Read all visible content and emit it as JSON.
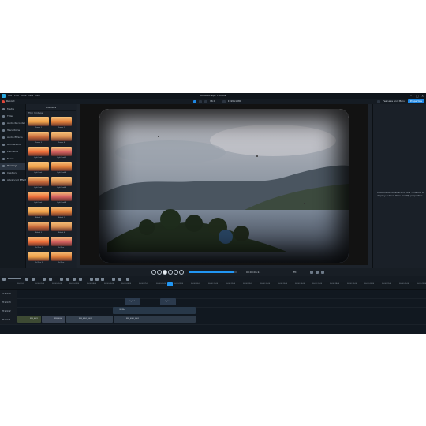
{
  "menubar": {
    "items": [
      "File",
      "Edit",
      "Tools",
      "View",
      "Help"
    ],
    "title": "Untitled.wfp - Filmora"
  },
  "toolbar": {
    "record_label": "Record",
    "aspect": "16:9",
    "resolution": "1920x1080",
    "features_label": "Features and Menu",
    "properties_label": "Properties"
  },
  "sidebar": {
    "items": [
      {
        "label": "Media",
        "icon": "media-icon"
      },
      {
        "label": "Titles",
        "icon": "text-icon"
      },
      {
        "label": "Audio Recorder",
        "icon": "microphone-icon"
      },
      {
        "label": "Transitions",
        "icon": "transition-icon"
      },
      {
        "label": "Audio Effects",
        "icon": "audio-icon"
      },
      {
        "label": "Animations",
        "icon": "animation-icon"
      },
      {
        "label": "Elements",
        "icon": "element-icon"
      },
      {
        "label": "Music",
        "icon": "music-icon"
      },
      {
        "label": "Overlays",
        "icon": "overlay-icon"
      },
      {
        "label": "Captions",
        "icon": "caption-icon"
      },
      {
        "label": "Advanced Effects",
        "icon": "effects-icon"
      }
    ],
    "active_index": 8
  },
  "filters": {
    "header": "Overlays",
    "search": "Film   Vintage",
    "items": [
      {
        "label": "Frame 1"
      },
      {
        "label": "Frame 2"
      },
      {
        "label": "Frame 3"
      },
      {
        "label": "Frame 4"
      },
      {
        "label": "Light Leak 1"
      },
      {
        "label": "Light Leak 2"
      },
      {
        "label": "Light Leak 3"
      },
      {
        "label": "Light Leak 4"
      },
      {
        "label": "Light Leak 5"
      },
      {
        "label": "Light Leak 6"
      },
      {
        "label": "Light Leak 7"
      },
      {
        "label": "Light Leak 8"
      },
      {
        "label": "Bokeh 1"
      },
      {
        "label": "Bokeh 2"
      },
      {
        "label": "Bokeh 3"
      },
      {
        "label": "Bokeh 4"
      },
      {
        "label": "Old Film 1"
      },
      {
        "label": "Old Film 2"
      },
      {
        "label": "Old Film 3"
      },
      {
        "label": "Old Film 4"
      }
    ]
  },
  "playback": {
    "current_time": "00:00:06:13",
    "fit_label": "Fit",
    "progress": 0.95
  },
  "properties": {
    "message": "Click media or effects in the Timeline to display it here, then modify properties."
  },
  "timeline": {
    "ruler_ticks": [
      "00:00:00",
      "00:00:01:00",
      "00:00:02:00",
      "00:00:03:00",
      "00:00:04:00",
      "00:00:05:00",
      "00:00:06:00",
      "00:00:07:00",
      "00:00:08:00",
      "00:00:09:00",
      "00:00:10:00",
      "00:00:11:00",
      "00:00:12:00",
      "00:00:13:00",
      "00:00:14:00",
      "00:00:15:00",
      "00:00:16:00",
      "00:00:17:00",
      "00:00:18:00",
      "00:00:19:00",
      "00:00:20:00",
      "00:00:21:00",
      "00:00:22:00",
      "00:00:23:00"
    ],
    "playhead_time": "00:00:06:13",
    "tracks": [
      {
        "label": "Track 4"
      },
      {
        "label": "Track 3"
      },
      {
        "label": "Track 2"
      },
      {
        "label": "Track 1"
      }
    ],
    "clips": {
      "t3a": "Light 1",
      "t3b": "Light 2",
      "t2": "Old Film",
      "t1a": "IMG_0021",
      "t1b": "IMG_0034",
      "t1c": "IMG_0052_0001",
      "t1d": "IMG_0060_0001"
    }
  },
  "colors": {
    "accent": "#1e88e5",
    "record": "#e0473a",
    "bg": "#1b2129"
  }
}
